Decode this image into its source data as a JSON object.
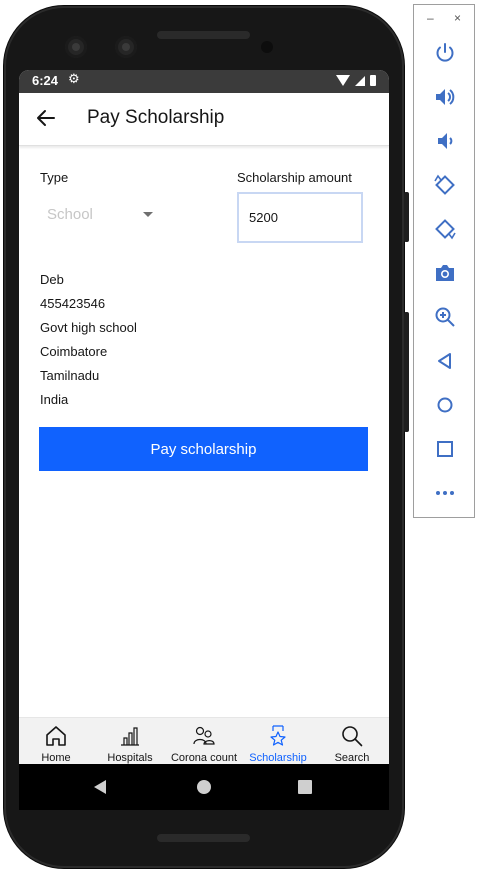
{
  "status_bar": {
    "time": "6:24",
    "gear_icon": "gear-icon"
  },
  "app_bar": {
    "title": "Pay Scholarship",
    "back_icon": "arrow-left-icon"
  },
  "form": {
    "type_label": "Type",
    "type_value": "School",
    "amount_label": "Scholarship amount",
    "amount_value": "5200"
  },
  "details": [
    "Deb",
    "455423546",
    "Govt high school",
    "Coimbatore",
    "Tamilnadu",
    "India"
  ],
  "pay_button": "Pay scholarship",
  "bottom_nav": [
    {
      "label": "Home",
      "icon": "home-icon",
      "active": false
    },
    {
      "label": "Hospitals",
      "icon": "chart-bar-icon",
      "active": false
    },
    {
      "label": "Corona count",
      "icon": "users-icon",
      "active": false
    },
    {
      "label": "Scholarship",
      "icon": "badge-icon",
      "active": true
    },
    {
      "label": "Search",
      "icon": "search-icon",
      "active": false
    }
  ],
  "window_controls": {
    "minimize": "–",
    "close": "×"
  },
  "emulator_tools": [
    "power-icon",
    "volume-up-icon",
    "volume-down-icon",
    "rotate-left-icon",
    "rotate-right-icon",
    "camera-icon",
    "zoom-icon",
    "back-icon",
    "home-icon",
    "overview-icon",
    "more-icon"
  ],
  "colors": {
    "accent": "#1062fe",
    "text": "#161616",
    "placeholder": "#c6c6c6",
    "nav_bg": "#f2f2f2"
  }
}
